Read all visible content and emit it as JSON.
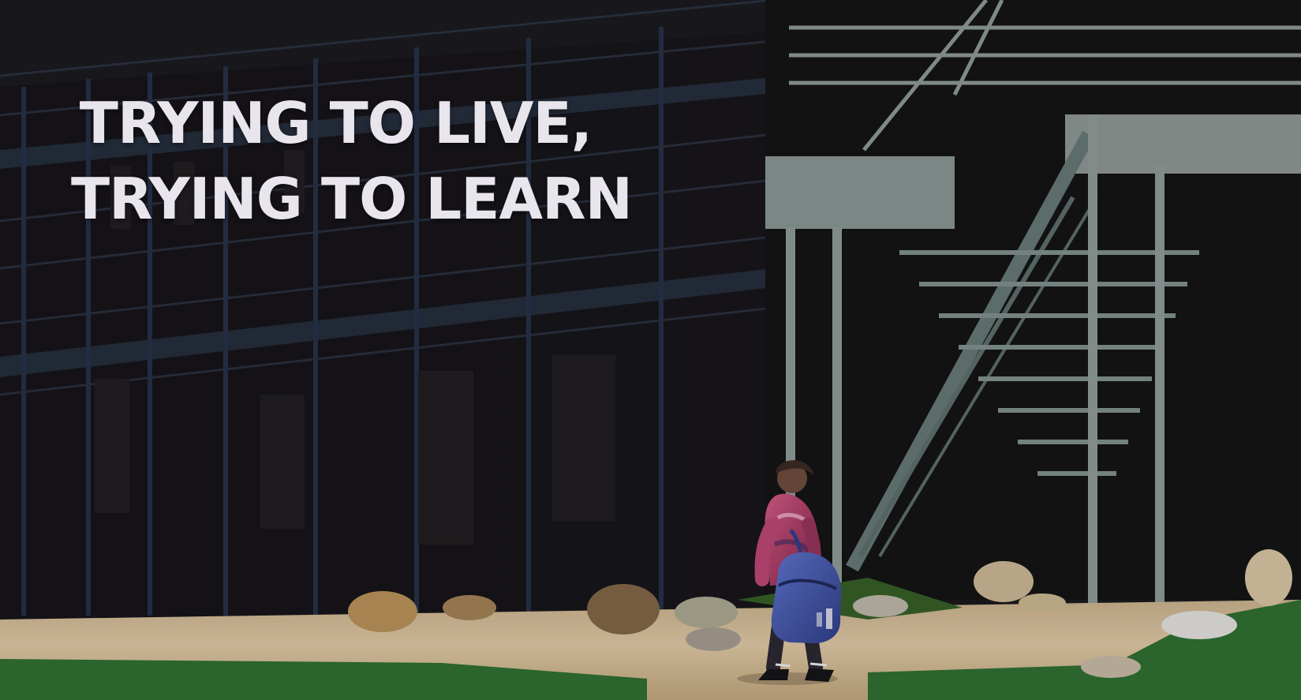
{
  "hero": {
    "headline_line_1": "TRYING TO LIVE,",
    "headline_line_2": "TRYING TO LEARN"
  },
  "colors": {
    "headline_text": "#e8e5ec",
    "shadowed_building": "#151419",
    "sunlit_dirt": "#d8c3a1",
    "grass": "#2f6d31",
    "stair_metal": "#697b79",
    "backpack": "#3c4fa6"
  }
}
